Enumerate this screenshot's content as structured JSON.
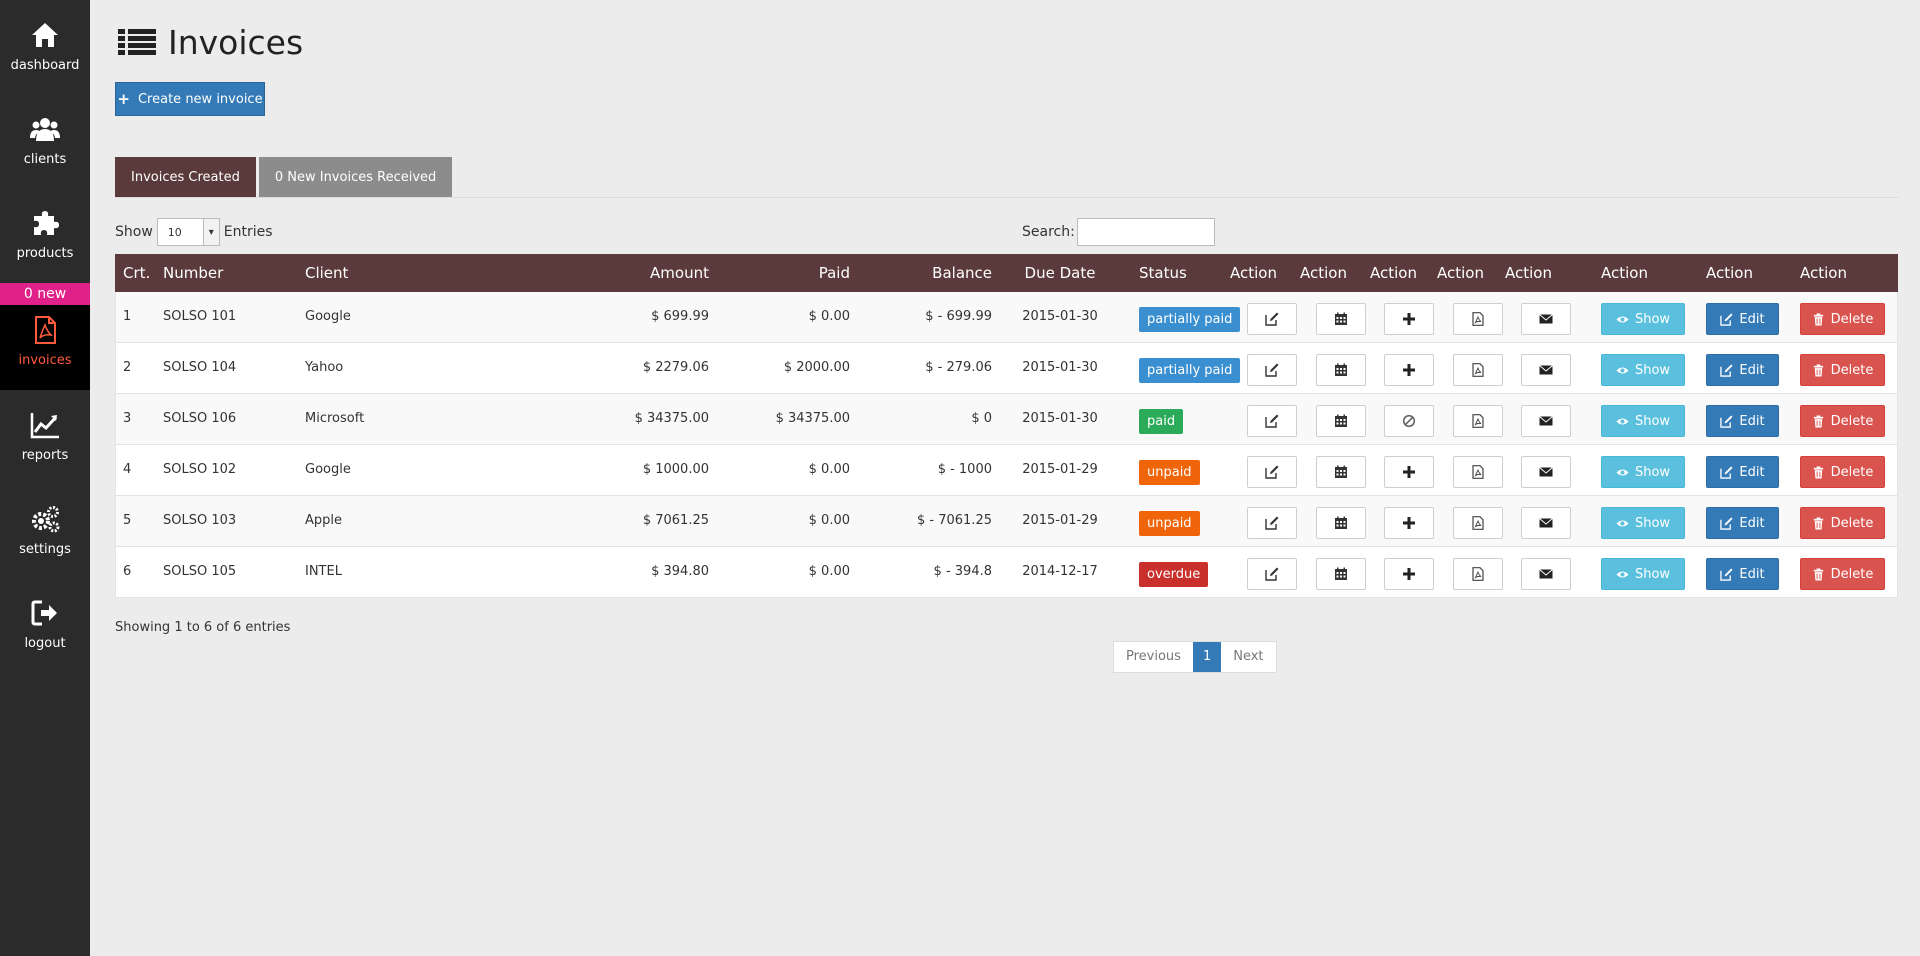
{
  "sidebar": {
    "items": [
      {
        "label": "dashboard",
        "icon": "home-icon"
      },
      {
        "label": "clients",
        "icon": "users-icon"
      },
      {
        "label": "products",
        "icon": "puzzle-icon"
      },
      {
        "label": "invoices",
        "icon": "file-pdf-icon"
      },
      {
        "label": "reports",
        "icon": "chart-line-icon"
      },
      {
        "label": "settings",
        "icon": "gears-icon"
      },
      {
        "label": "logout",
        "icon": "sign-out-icon"
      }
    ],
    "badge": "0 new",
    "active_color": "#ff5a3d",
    "badge_color": "#e0218a"
  },
  "page": {
    "title": "Invoices",
    "create_button": "Create new invoice"
  },
  "tabs": [
    {
      "label": "Invoices Created",
      "active": true
    },
    {
      "label": "0 New Invoices Received",
      "active": false
    }
  ],
  "table_controls": {
    "show_label": "Show",
    "page_length": "10",
    "entries_label": "Entries",
    "search_label": "Search:",
    "search_value": ""
  },
  "table": {
    "headers": [
      "Crt.",
      "Number",
      "Client",
      "Amount",
      "Paid",
      "Balance",
      "Due Date",
      "Status",
      "Action",
      "Action",
      "Action",
      "Action",
      "Action",
      "Action",
      "Action",
      "Action"
    ],
    "action_labels": {
      "show": "Show",
      "edit": "Edit",
      "delete": "Delete"
    },
    "rows": [
      {
        "crt": "1",
        "number": "SOLSO 101",
        "client": "Google",
        "amount": "$ 699.99",
        "paid": "$ 0.00",
        "balance": "$ - 699.99",
        "due_date": "2015-01-30",
        "status": "partially paid",
        "status_color": "#3a8fd0",
        "payment_icon": "plus-icon"
      },
      {
        "crt": "2",
        "number": "SOLSO 104",
        "client": "Yahoo",
        "amount": "$ 2279.06",
        "paid": "$ 2000.00",
        "balance": "$ - 279.06",
        "due_date": "2015-01-30",
        "status": "partially paid",
        "status_color": "#3a8fd0",
        "payment_icon": "plus-icon"
      },
      {
        "crt": "3",
        "number": "SOLSO 106",
        "client": "Microsoft",
        "amount": "$ 34375.00",
        "paid": "$ 34375.00",
        "balance": "$ 0",
        "due_date": "2015-01-30",
        "status": "paid",
        "status_color": "#2bab5a",
        "payment_icon": "ban-icon"
      },
      {
        "crt": "4",
        "number": "SOLSO 102",
        "client": "Google",
        "amount": "$ 1000.00",
        "paid": "$ 0.00",
        "balance": "$ - 1000",
        "due_date": "2015-01-29",
        "status": "unpaid",
        "status_color": "#f0650a",
        "payment_icon": "plus-icon"
      },
      {
        "crt": "5",
        "number": "SOLSO 103",
        "client": "Apple",
        "amount": "$ 7061.25",
        "paid": "$ 0.00",
        "balance": "$ - 7061.25",
        "due_date": "2015-01-29",
        "status": "unpaid",
        "status_color": "#f0650a",
        "payment_icon": "plus-icon"
      },
      {
        "crt": "6",
        "number": "SOLSO 105",
        "client": "INTEL",
        "amount": "$ 394.80",
        "paid": "$ 0.00",
        "balance": "$ - 394.8",
        "due_date": "2014-12-17",
        "status": "overdue",
        "status_color": "#c9302c",
        "payment_icon": "plus-icon"
      }
    ]
  },
  "footer": {
    "info": "Showing 1 to 6 of 6 entries",
    "previous": "Previous",
    "current_page": "1",
    "next": "Next"
  },
  "colors": {
    "header_bg": "#5a3a3a",
    "primary": "#337ab7",
    "info": "#5bc0de",
    "danger": "#d9534f"
  }
}
